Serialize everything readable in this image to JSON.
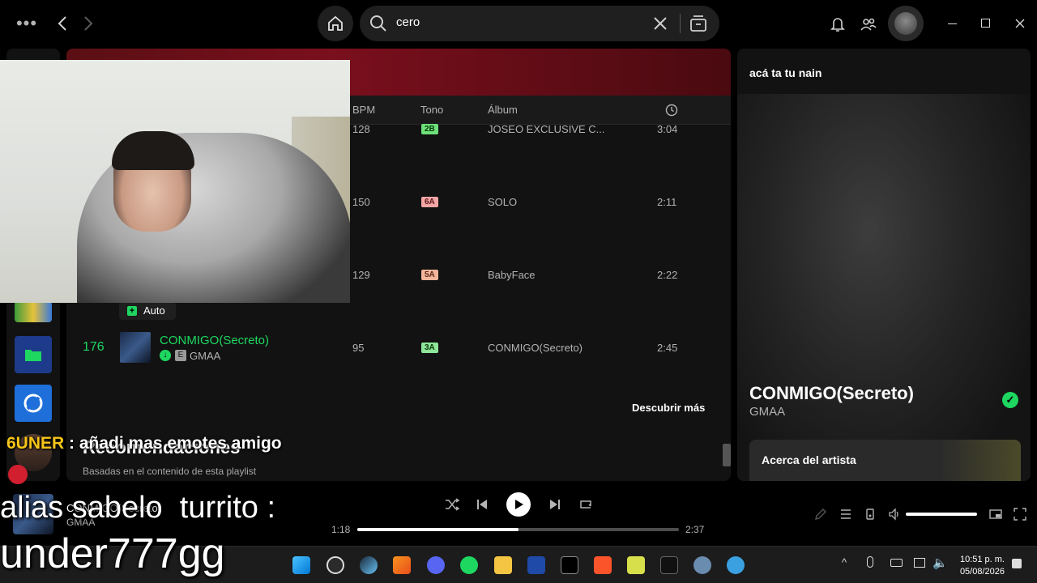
{
  "search": {
    "value": "cero"
  },
  "table": {
    "headers": {
      "bpm": "BPM",
      "key": "Tono",
      "album": "Álbum"
    },
    "rows": [
      {
        "bpm": "128",
        "key": "2B",
        "key_color": "#6ee07a",
        "album": "JOSEO EXCLUSIVE C...",
        "duration": "3:04"
      },
      {
        "bpm": "150",
        "key": "6A",
        "key_color": "#f4a6a6",
        "album": "SOLO",
        "duration": "2:11"
      },
      {
        "bpm": "129",
        "key": "5A",
        "key_color": "#f4b59a",
        "album": "BabyFace",
        "duration": "2:22"
      },
      {
        "index": "176",
        "title": "CONMIGO(Secreto)",
        "explicit": "E",
        "artist": "GMAA",
        "bpm": "95",
        "key": "3A",
        "key_color": "#8fe59a",
        "album": "CONMIGO(Secreto)",
        "duration": "2:45"
      }
    ],
    "auto_label": "Auto",
    "discover_more": "Descubrir más"
  },
  "recommendations": {
    "title": "Recomendaciones",
    "subtitle": "Basadas en el contenido de esta playlist"
  },
  "right_panel": {
    "header": "acá ta tu nain",
    "now_title": "CONMIGO(Secreto)",
    "now_artist": "GMAA",
    "about_label": "Acerca del artista"
  },
  "player": {
    "current_time": "1:18",
    "total_time": "2:37",
    "progress": 0.5,
    "track_title": "CONMIGO(Secreto)",
    "track_artist": "GMAA"
  },
  "taskbar": {
    "time": "10:51 p. m.",
    "date": "05/08/2026"
  },
  "overlay": {
    "chat_user": "6UNER",
    "chat_sep": " : ",
    "chat_message": "añadi mas emotes amigo",
    "line1": "alias sabelo  turrito :",
    "line2": "under777gg"
  },
  "colors": {
    "accent": "#1ed760",
    "background": "#121212"
  }
}
